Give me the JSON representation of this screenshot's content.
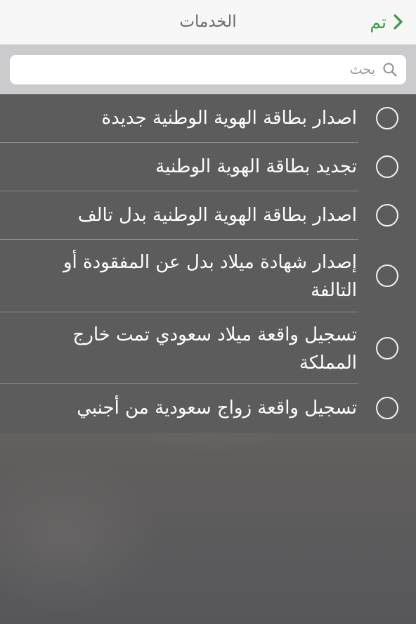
{
  "navbar": {
    "title": "الخدمات",
    "done_label": "تم",
    "accent_color": "#3a9a4a"
  },
  "search": {
    "value": "",
    "placeholder": "بحث"
  },
  "services": [
    {
      "label": "اصدار بطاقة الهوية الوطنية جديدة",
      "selected": false
    },
    {
      "label": "تجديد بطاقة الهوية الوطنية",
      "selected": false
    },
    {
      "label": "اصدار بطاقة الهوية الوطنية بدل تالف",
      "selected": false
    },
    {
      "label": "إصدار شهادة ميلاد بدل عن المفقودة أو التالفة",
      "selected": false
    },
    {
      "label": "تسجيل واقعة ميلاد سعودي تمت خارج المملكة",
      "selected": false
    },
    {
      "label": "تسجيل واقعة زواج سعودية من أجنبي",
      "selected": false
    }
  ]
}
